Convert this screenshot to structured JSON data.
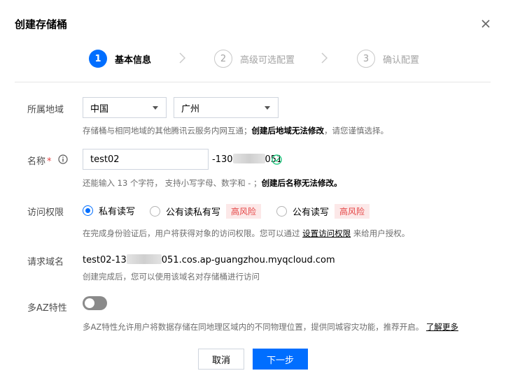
{
  "dialog": {
    "title": "创建存储桶",
    "close_icon": "close-icon"
  },
  "steps": [
    {
      "number": "1",
      "label": "基本信息",
      "state": "active"
    },
    {
      "number": "2",
      "label": "高级可选配置",
      "state": "inactive"
    },
    {
      "number": "3",
      "label": "确认配置",
      "state": "inactive"
    }
  ],
  "region": {
    "label": "所属地域",
    "country_value": "中国",
    "city_value": "广州",
    "hint_prefix": "存储桶与相同地域的其他腾讯云服务内网互通；",
    "hint_bold": "创建后地域无法修改",
    "hint_suffix": "，请您谨慎选择。"
  },
  "name": {
    "label": "名称",
    "required_mark": "*",
    "info_icon": "info-icon",
    "value": "test02",
    "suffix_prefix": "-130",
    "suffix_end": "051",
    "valid_icon": "check-circle-icon",
    "hint_prefix": "还能输入 13 个字符， 支持小写字母、数字和 - ；",
    "hint_bold": "创建后名称无法修改。"
  },
  "access": {
    "label": "访问权限",
    "options": [
      {
        "label": "私有读写",
        "checked": true,
        "risk": ""
      },
      {
        "label": "公有读私有写",
        "checked": false,
        "risk": "高风险"
      },
      {
        "label": "公有读写",
        "checked": false,
        "risk": "高风险"
      }
    ],
    "hint_prefix": "在完成身份验证后，用户将获得对象的访问权限。您可以通过",
    "hint_link": "设置访问权限",
    "hint_suffix": "来给用户授权。"
  },
  "domain": {
    "label": "请求域名",
    "value_prefix": "test02-13",
    "value_suffix": "051.cos.ap-guangzhou.myqcloud.com",
    "hint": "创建完成后，您可以使用该域名对存储桶进行访问"
  },
  "multi_az": {
    "label": "多AZ特性",
    "enabled": false,
    "hint": "多AZ特性允许用户将数据存储在同地理区域内的不同物理位置，提供同城容灾功能，推荐开启。",
    "link": "了解更多"
  },
  "buttons": {
    "cancel": "取消",
    "next": "下一步"
  },
  "colors": {
    "primary": "#006eff",
    "danger": "#e54545",
    "success": "#29cc85"
  }
}
